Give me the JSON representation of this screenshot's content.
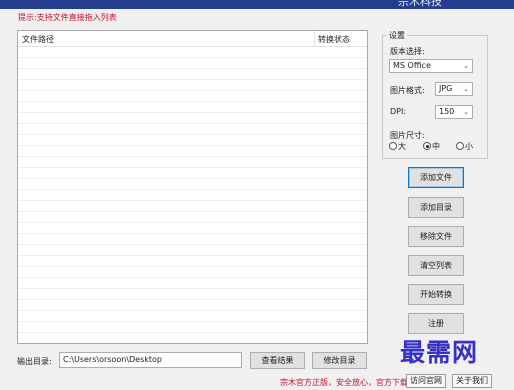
{
  "window": {
    "title": "宗木科技"
  },
  "hint": "提示:支持文件直接拖入列表",
  "file_list": {
    "columns": [
      "文件路径",
      "转换状态"
    ],
    "rows": []
  },
  "settings": {
    "group_title": "设置",
    "version_label": "版本选择:",
    "version_value": "MS Office",
    "format_label": "图片格式:",
    "format_value": "JPG",
    "dpi_label": "DPI:",
    "dpi_value": "150",
    "size_label": "图片尺寸:",
    "size_options": [
      "大",
      "中",
      "小"
    ],
    "size_selected": "中"
  },
  "buttons": {
    "add_file": "添加文件",
    "add_dir": "添加目录",
    "remove_file": "移除文件",
    "clear_list": "清空列表",
    "start": "开始转换",
    "register": "注册"
  },
  "output": {
    "label": "输出目录:",
    "path": "C:\\Users\\orsoon\\Desktop",
    "view_button": "查看结果",
    "change_button": "修改目录"
  },
  "watermark": "最需网",
  "footer": {
    "text": "宗木官方正版，安全放心，官方下载--->>",
    "site_link": "访问官网",
    "about_link": "关于我们"
  },
  "colors": {
    "titlebar": "#243d8c",
    "hint": "#c8102e",
    "watermark": "#3530c8"
  }
}
